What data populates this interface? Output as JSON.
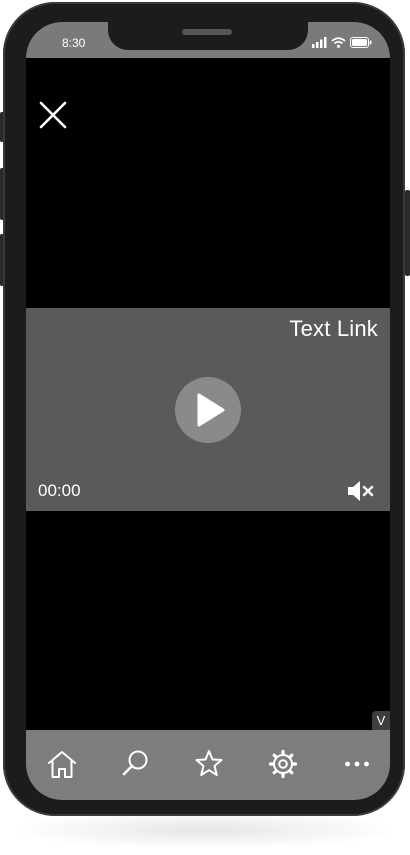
{
  "status_bar": {
    "time": "8:30"
  },
  "icons": {
    "close": "close-icon",
    "play": "play-icon",
    "mute": "mute-icon",
    "nav": [
      "home-icon",
      "search-icon",
      "star-icon",
      "gear-icon",
      "more-icon"
    ]
  },
  "video": {
    "link_label": "Text Link",
    "time": "00:00"
  },
  "badge": "V",
  "colors": {
    "status_bar": "#7a7a7a",
    "video_background": "#5a5a5a",
    "play_button": "#8a8a8a",
    "nav_bar": "#7d7d7d",
    "screen_background": "#000000"
  }
}
